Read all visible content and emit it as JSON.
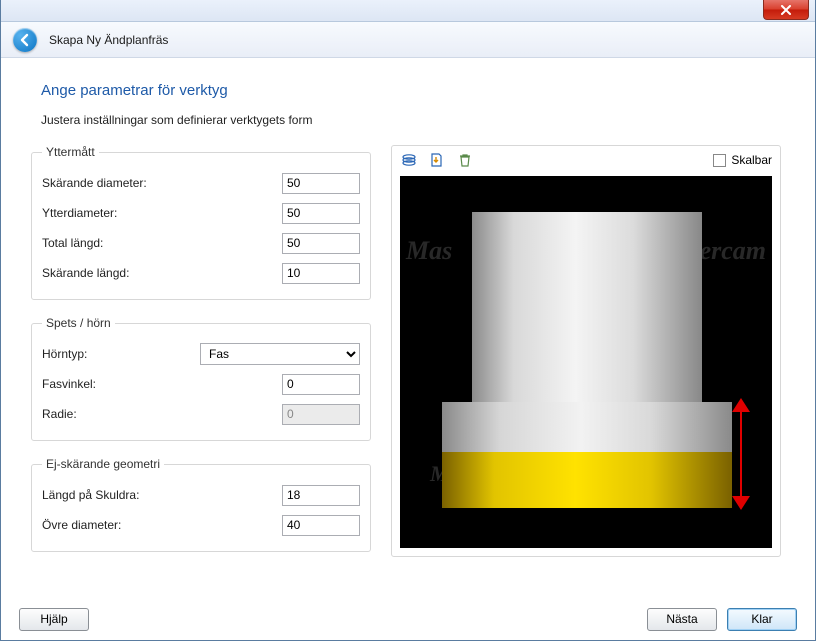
{
  "header": {
    "title": "Skapa Ny Ändplanfräs"
  },
  "page": {
    "title": "Ange parametrar för verktyg",
    "subtitle": "Justera inställningar som definierar verktygets form"
  },
  "groups": {
    "outer": {
      "legend": "Yttermått",
      "cut_diameter_label": "Skärande diameter:",
      "cut_diameter_value": "50",
      "outer_diameter_label": "Ytterdiameter:",
      "outer_diameter_value": "50",
      "total_length_label": "Total längd:",
      "total_length_value": "50",
      "cut_length_label": "Skärande längd:",
      "cut_length_value": "10"
    },
    "tip": {
      "legend": "Spets / hörn",
      "corner_type_label": "Hörntyp:",
      "corner_type_selected": "Fas",
      "chamfer_angle_label": "Fasvinkel:",
      "chamfer_angle_value": "0",
      "radius_label": "Radie:",
      "radius_value": "0"
    },
    "noncut": {
      "legend": "Ej-skärande geometri",
      "shoulder_length_label": "Längd på Skuldra:",
      "shoulder_length_value": "18",
      "upper_diameter_label": "Övre diameter:",
      "upper_diameter_value": "40"
    }
  },
  "preview": {
    "scalable_label": "Skalbar",
    "watermark_left": "Mas",
    "watermark_right": "ercam",
    "watermark_full": "Mastercam",
    "icons": {
      "layers": "layers-icon",
      "import": "import-icon",
      "delete": "delete-icon"
    }
  },
  "footer": {
    "help": "Hjälp",
    "next": "Nästa",
    "finish": "Klar"
  }
}
